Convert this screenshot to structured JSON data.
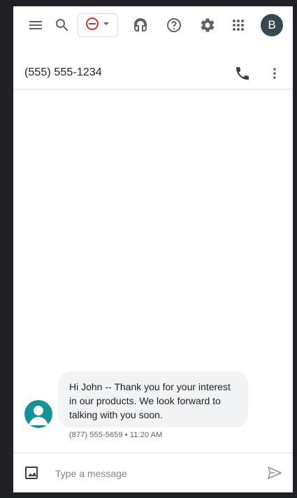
{
  "topbar": {
    "icons": {
      "menu": "menu-icon",
      "search": "search-icon",
      "status": "do-not-disturb-icon",
      "status_dropdown": "arrow-drop-down-icon",
      "headset": "headset-icon",
      "help": "help-icon",
      "settings": "gear-icon",
      "apps": "apps-grid-icon"
    },
    "status_color": "#d93025",
    "account_initial": "B",
    "account_color": "#37474f"
  },
  "conversation": {
    "title": "(555) 555-1234",
    "icons": {
      "call": "phone-icon",
      "more": "more-vert-icon"
    }
  },
  "messages": [
    {
      "text": "Hi John -- Thank you for your interest in our products. We look forward to talking with you soon.",
      "meta": "(877) 555-5659 • 11:20 AM",
      "avatar_color": "#12939a"
    }
  ],
  "composer": {
    "placeholder": "Type a message",
    "icons": {
      "attach": "image-icon",
      "send": "send-icon"
    }
  }
}
